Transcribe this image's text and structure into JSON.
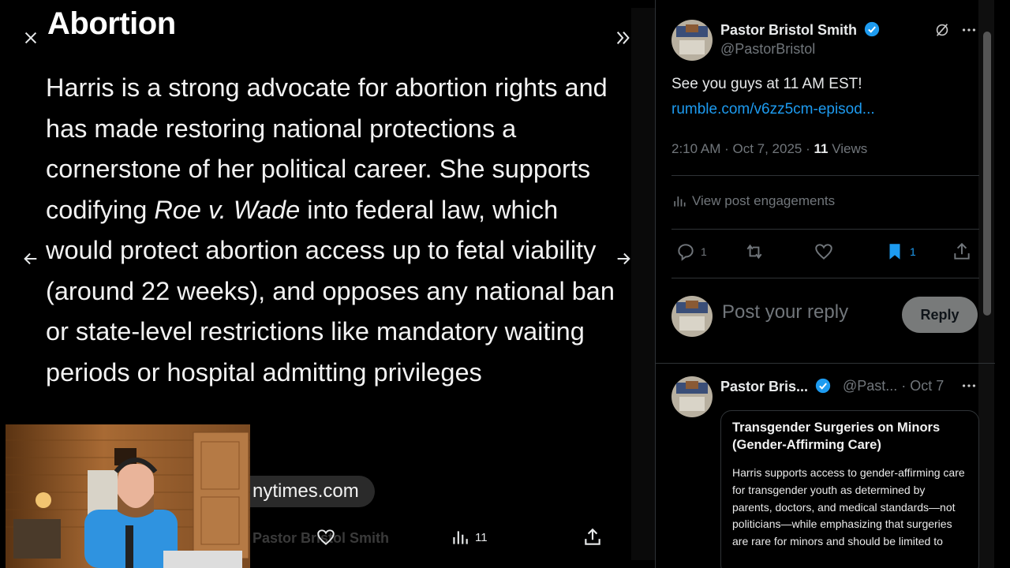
{
  "viewer": {
    "title": "Abortion",
    "body_pre": "Harris is a strong advocate for abortion rights and has made restoring national protections a cornerstone of her political career. She supports codifying ",
    "body_italic": "Roe v. Wade",
    "body_post": " into federal law, which would protect abortion access up to fetal viability (around 22 weeks), and opposes any national ban or state-level restrictions like mandatory waiting periods or hospital admitting privileges",
    "source": "nytimes.com",
    "ghost_author": "Pastor Bristol Smith",
    "views": "11"
  },
  "tweet": {
    "author": "Pastor Bristol Smith",
    "handle": "@PastorBristol",
    "text": "See you guys at 11 AM EST!",
    "link": "rumble.com/v6zz5cm-episod...",
    "time": "2:10 AM · Oct 7, 2025 · ",
    "views_count": "11",
    "views_label": " Views",
    "engagements": "View post engagements",
    "reply_count": "1",
    "bookmark_count": "1",
    "colors": {
      "accent": "#1d9bf0",
      "muted": "#71767b"
    }
  },
  "composer": {
    "placeholder": "Post your reply",
    "button": "Reply"
  },
  "reply": {
    "author": "Pastor Bris...",
    "handle": "@Past...",
    "date": " · Oct 7",
    "card_title": "Transgender Surgeries on Minors (Gender-Affirming Care)",
    "card_body": "Harris supports access to gender-affirming care for transgender youth as determined by parents, doctors, and medical standards—not politicians—while emphasizing that surgeries are rare for minors and should be limited to"
  }
}
